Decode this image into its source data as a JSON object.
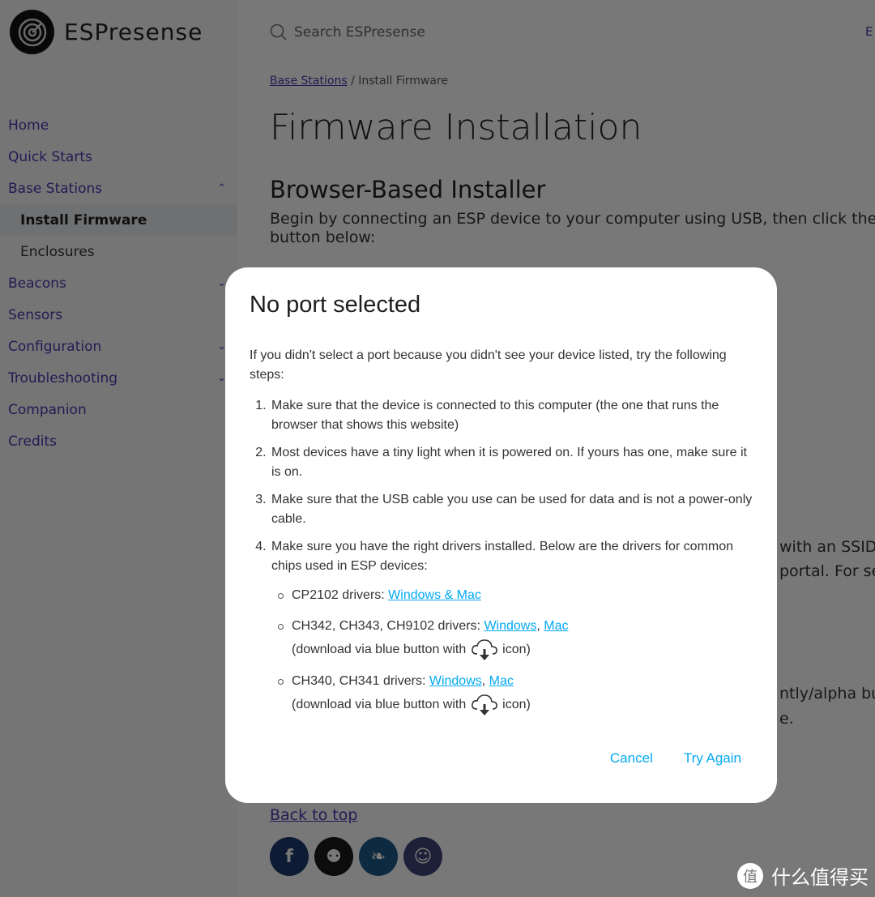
{
  "brand": {
    "name": "ESPresense"
  },
  "search": {
    "placeholder": "Search ESPresense"
  },
  "topbar_right": "E",
  "sidebar": {
    "items": [
      {
        "label": "Home",
        "chevron": ""
      },
      {
        "label": "Quick Starts",
        "chevron": ""
      },
      {
        "label": "Base Stations",
        "chevron": "^"
      },
      {
        "label": "Install Firmware",
        "chevron": "",
        "sub": true,
        "active": true
      },
      {
        "label": "Enclosures",
        "chevron": "",
        "sub": true
      },
      {
        "label": "Beacons",
        "chevron": "v"
      },
      {
        "label": "Sensors",
        "chevron": ""
      },
      {
        "label": "Configuration",
        "chevron": "v"
      },
      {
        "label": "Troubleshooting",
        "chevron": "v"
      },
      {
        "label": "Companion",
        "chevron": ""
      },
      {
        "label": "Credits",
        "chevron": ""
      }
    ]
  },
  "breadcrumb": {
    "parent": "Base Stations",
    "sep": "/",
    "current": "Install Firmware"
  },
  "main": {
    "title": "Firmware Installation",
    "section": "Browser-Based Installer",
    "lead": "Begin by connecting an ESP device to your computer using USB, then click the “C",
    "lead2": "button below:",
    "frag1": "with an SSID b",
    "frag2": "portal. For set",
    "frag3": "ntly/alpha bu",
    "frag4": "e.",
    "back_to_top": "Back to top"
  },
  "socials": [
    {
      "name": "facebook",
      "glyph": "f",
      "color": "#1d3a6e"
    },
    {
      "name": "github",
      "glyph": "⚉",
      "color": "#1a1a1a"
    },
    {
      "name": "twitter",
      "glyph": "❧",
      "color": "#1c5a8a"
    },
    {
      "name": "discord",
      "glyph": "☺",
      "color": "#3d4478"
    }
  ],
  "dialog": {
    "title": "No port selected",
    "intro": "If you didn't select a port because you didn't see your device listed, try the following steps:",
    "steps": [
      "Make sure that the device is connected to this computer (the one that runs the browser that shows this website)",
      "Most devices have a tiny light when it is powered on. If yours has one, make sure it is on.",
      "Make sure that the USB cable you use can be used for data and is not a power-only cable.",
      "Make sure you have the right drivers installed. Below are the drivers for common chips used in ESP devices:"
    ],
    "drivers": [
      {
        "label": "CP2102 drivers: ",
        "link1": "Windows & Mac"
      },
      {
        "label": "CH342, CH343, CH9102 drivers: ",
        "link1": "Windows",
        "sep": ", ",
        "link2": "Mac",
        "note_pre": "(download via blue button with ",
        "note_post": " icon)"
      },
      {
        "label": "CH340, CH341 drivers: ",
        "link1": "Windows",
        "sep": ", ",
        "link2": "Mac",
        "note_pre": "(download via blue button with ",
        "note_post": " icon)"
      }
    ],
    "cancel": "Cancel",
    "try_again": "Try Again"
  },
  "watermark": {
    "glyph": "值",
    "text": "什么值得买"
  },
  "colors": {
    "link": "#03a9f4",
    "nav": "#4b3ab0"
  }
}
